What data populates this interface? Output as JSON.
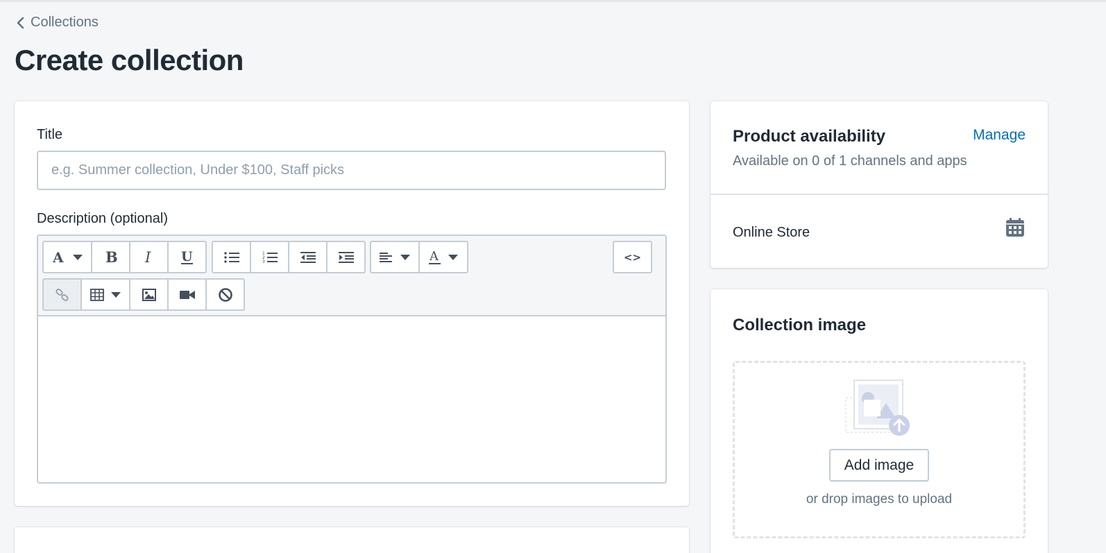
{
  "breadcrumb": {
    "label": "Collections",
    "icon": "chevron-left-icon"
  },
  "page": {
    "title": "Create collection"
  },
  "form": {
    "title_label": "Title",
    "title_value": "",
    "title_placeholder": "e.g. Summer collection, Under $100, Staff picks",
    "description_label": "Description (optional)",
    "description_value": ""
  },
  "toolbar": {
    "row1": [
      [
        "font-icon",
        "bold-icon",
        "italic-icon",
        "underline-icon"
      ],
      [
        "bullet-list-icon",
        "numbered-list-icon",
        "outdent-icon",
        "indent-icon"
      ],
      [
        "align-left-icon",
        "text-color-icon"
      ],
      [
        "code-view-icon"
      ]
    ],
    "row2": [
      [
        "link-icon",
        "table-icon",
        "image-icon",
        "video-icon",
        "clear-formatting-icon"
      ]
    ],
    "code_label": "<>"
  },
  "product_availability": {
    "title": "Product availability",
    "manage_label": "Manage",
    "subtitle": "Available on 0 of 1 channels and apps",
    "channels": [
      {
        "name": "Online Store",
        "icon": "calendar-icon"
      }
    ]
  },
  "collection_image": {
    "title": "Collection image",
    "add_button_label": "Add image",
    "hint": "or drop images to upload",
    "icon": "upload-image-icon"
  },
  "colors": {
    "link": "#006fbb",
    "text": "#212b36",
    "subdued": "#637381",
    "background": "#f4f6f8",
    "border": "#c4cdd5"
  }
}
